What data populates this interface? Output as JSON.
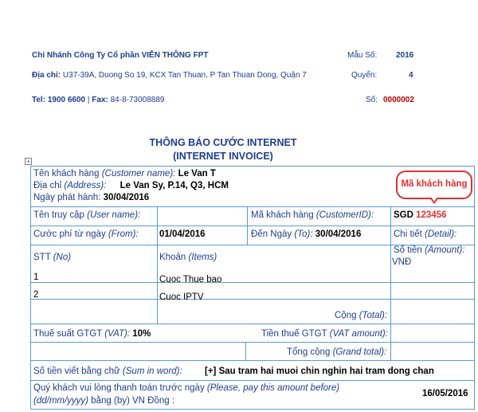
{
  "header": {
    "company": "Chi Nhánh Công Ty Cổ phần VIỄN THÔNG FPT",
    "address_label": "Địa chỉ:",
    "address_value": "U37-39A, Duong So 19, KCX Tan Thuan, P Tan Thuan Dong, Quận 7",
    "phone_label": "Tel: 1900 6600",
    "fax_sep": "|",
    "fax_label": "Fax:",
    "fax_value": "84-8-73008889",
    "form_label": "Mẫu Số:",
    "form_value": "2016",
    "book_label": "Quyển:",
    "book_value": "4",
    "number_label": "Số:",
    "number_value": "0000002"
  },
  "title": {
    "line1": "THÔNG BÁO CƯỚC INTERNET",
    "line2": "(INTERNET INVOICE)"
  },
  "customer": {
    "name_label": "Tên khách hàng",
    "name_label_en": "(Customer name):",
    "name_value": "Le Van T",
    "address_label": "Địa chỉ",
    "address_label_en": "(Address):",
    "address_value": "Le Van Sy, P.14, Q3, HCM",
    "issue_label": "Ngày phát hành:",
    "issue_value": "30/04/2016",
    "callout": "Mã khách hàng"
  },
  "account": {
    "username_label": "Tên truy cập",
    "username_label_en": "(User name):",
    "customer_id_label": "Mã khách hàng",
    "customer_id_label_en": "(CustomerID):",
    "customer_id_prefix": "SGD",
    "customer_id_value": "123456"
  },
  "period": {
    "from_label": "Cước phí từ ngày",
    "from_label_en": "(From):",
    "from_value": "01/04/2016",
    "to_label": "Đến Ngày",
    "to_label_en": "(To):",
    "to_value": "30/04/2016",
    "detail_label": "Chi tiết",
    "detail_label_en": "(Detail):"
  },
  "items": {
    "col_no": "STT",
    "col_no_en": "(No)",
    "col_item": "Khoản",
    "col_item_en": "(Items)",
    "col_amount": "Số tiền",
    "col_amount_en": "(Amount):",
    "col_amount_unit": "VNĐ",
    "rows": [
      {
        "no": "1",
        "item": "Cuoc Thue bao"
      },
      {
        "no": "2",
        "item": "Cuoc IPTV"
      }
    ]
  },
  "totals": {
    "subtotal_label": "Cộng",
    "subtotal_label_en": "(Total):",
    "vat_rate_label": "Thuế suất GTGT",
    "vat_rate_label_en": "(VAT):",
    "vat_rate_value": "10%",
    "vat_amount_label": "Tiền thuế GTGT",
    "vat_amount_label_en": "(VAT amount):",
    "grand_label": "Tổng cộng",
    "grand_label_en": "(Grand total):",
    "words_label": "Số tiền viết bằng chữ",
    "words_label_en": "(Sum in word):",
    "words_value": "[+] Sau tram hai muoi chin nghin hai tram dong chan"
  },
  "payment": {
    "line1": "Quý khách vui lòng thanh toán trước ngày",
    "line1_en": "(Please, pay this amount before)",
    "line2_en": "(dd/mm/yyyy)",
    "line2_mid": "bằng",
    "line2_by": "(by)",
    "line2_end": "VN Đồng :",
    "due_value": "16/05/2016"
  },
  "colors": {
    "text_blue": "#1f3d8f",
    "border_blue": "#5b9bd5",
    "accent_red": "#c00000",
    "callout_red": "#e03030"
  }
}
